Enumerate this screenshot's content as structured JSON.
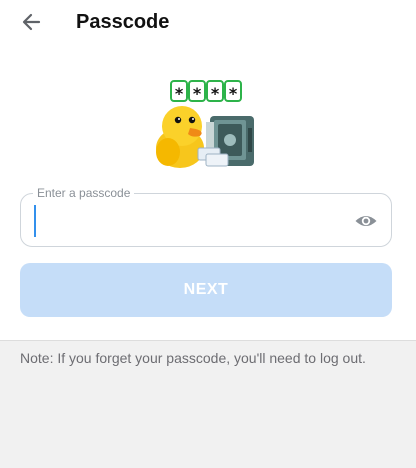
{
  "header": {
    "title": "Passcode",
    "back_icon": "arrow-left-icon"
  },
  "sticker": {
    "pin_chars": [
      "*",
      "*",
      "*",
      "*"
    ]
  },
  "passcode_field": {
    "label": "Enter a passcode",
    "value": "",
    "toggle_icon": "eye-icon"
  },
  "next_button": {
    "label": "NEXT"
  },
  "note": "Note: If you forget your passcode, you'll need to log out.",
  "colors": {
    "accent": "#3390ec",
    "button_disabled": "#c5ddf8",
    "background": "#f1f1f1"
  }
}
